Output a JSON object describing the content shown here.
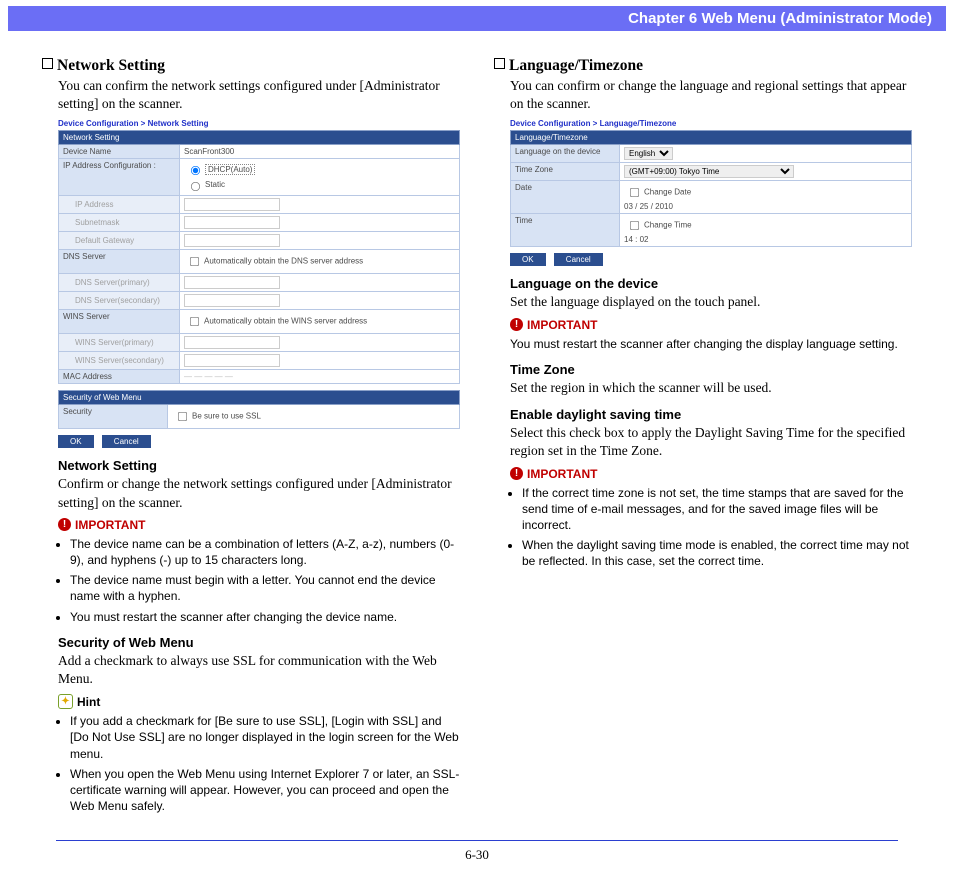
{
  "header": {
    "title": "Chapter 6   Web Menu (Administrator Mode)"
  },
  "footer": {
    "page": "6-30"
  },
  "left": {
    "title": "Network Setting",
    "intro": "You can confirm the network settings configured under [Administrator setting] on the scanner.",
    "shot": {
      "breadcrumb": "Device Configuration > Network Setting",
      "sect1": "Network Setting",
      "rows": {
        "deviceNameK": "Device Name",
        "deviceNameV": "ScanFront300",
        "ipcfgK": "IP Address Configuration :",
        "ipcfgDhcp": "DHCP(Auto)",
        "ipcfgStatic": "Static",
        "ipAddrK": "IP Address",
        "subnetK": "Subnetmask",
        "gatewayK": "Default Gateway",
        "dnsK": "DNS Server",
        "dnsAuto": "Automatically obtain the DNS server address",
        "dns1K": "DNS Server(primary)",
        "dns2K": "DNS Server(secondary)",
        "winsK": "WINS Server",
        "winsAuto": "Automatically obtain the WINS server address",
        "wins1K": "WINS Server(primary)",
        "wins2K": "WINS Server(secondary)",
        "macK": "MAC Address"
      },
      "sect2": "Security of Web Menu",
      "secRowK": "Security",
      "secRowV": "Be sure to use SSL",
      "ok": "OK",
      "cancel": "Cancel"
    },
    "sub1Head": "Network Setting",
    "sub1Body": "Confirm or change the network settings configured under [Administrator setting] on the scanner.",
    "imp1": [
      "The device name can be a combination of letters (A-Z, a-z), numbers (0-9), and hyphens (-) up to 15 characters long.",
      "The device name must begin with a letter. You cannot end the device name with a hyphen.",
      "You must restart the scanner after changing the device name."
    ],
    "sub2Head": "Security of Web Menu",
    "sub2Body": "Add a checkmark to always use SSL for communication with the Web Menu.",
    "hint": [
      "If you add a checkmark for [Be sure to use SSL], [Login with SSL] and [Do Not Use SSL] are no longer displayed in the login screen for the Web menu.",
      "When you open the Web Menu using Internet Explorer 7 or later, an SSL-certificate warning will appear. However, you can proceed and open the Web Menu safely."
    ],
    "labels": {
      "important": "IMPORTANT",
      "hint": "Hint"
    }
  },
  "right": {
    "title": "Language/Timezone",
    "intro": "You can confirm or change the language and regional settings that appear on the scanner.",
    "shot": {
      "breadcrumb": "Device Configuration > Language/Timezone",
      "sect": "Language/Timezone",
      "langK": "Language on the device",
      "langV": "English",
      "tzK": "Time Zone",
      "tzV": "(GMT+09:00) Tokyo Time",
      "dateK": "Date",
      "dateCh": "Change Date",
      "dateV": "03 / 25 / 2010",
      "timeK": "Time",
      "timeCh": "Change Time",
      "timeV": "14 : 02",
      "ok": "OK",
      "cancel": "Cancel"
    },
    "sub1Head": "Language on the device",
    "sub1Body": "Set the language displayed on the touch panel.",
    "imp1": "You must restart the scanner after changing the display language setting.",
    "sub2Head": "Time Zone",
    "sub2Body": "Set the region in which the scanner will be used.",
    "sub3Head": "Enable daylight saving time",
    "sub3Body": "Select this check box to apply the Daylight Saving Time for the specified region set in the Time Zone.",
    "imp2": [
      "If the correct time zone is not set, the time stamps that are saved for the send time of e-mail messages, and for the saved image files will be incorrect.",
      "When the daylight saving time mode is enabled, the correct time may not be reflected. In this case, set the correct time."
    ],
    "labels": {
      "important": "IMPORTANT"
    }
  }
}
